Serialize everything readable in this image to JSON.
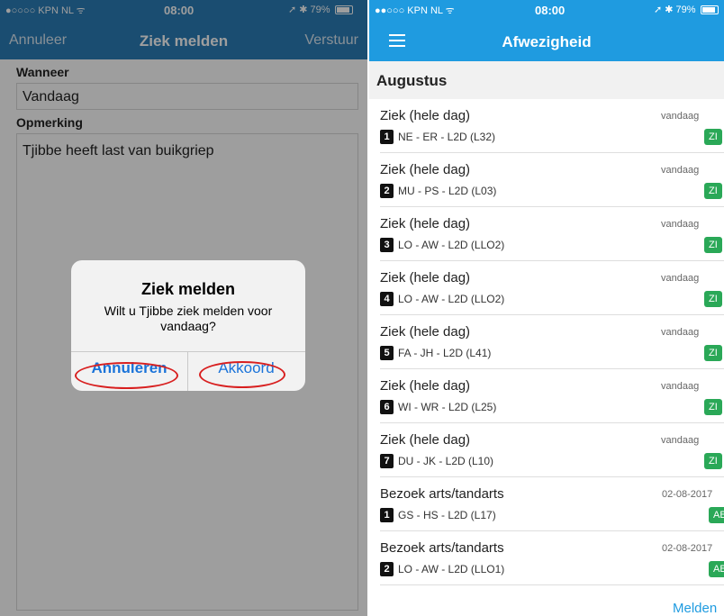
{
  "left": {
    "status": {
      "signal": "●○○○○ KPN NL ᯤ",
      "time": "08:00",
      "battery": "➚ ✱ 79%"
    },
    "nav": {
      "cancel": "Annuleer",
      "title": "Ziek melden",
      "send": "Verstuur"
    },
    "form": {
      "when_label": "Wanneer",
      "when_value": "Vandaag",
      "remark_label": "Opmerking",
      "remark_value": "Tjibbe heeft last van buikgriep"
    },
    "alert": {
      "title": "Ziek melden",
      "message": "Wilt u Tjibbe ziek melden voor vandaag?",
      "cancel": "Annuleren",
      "ok": "Akkoord"
    },
    "colors": {
      "nav": "#2a7cb6",
      "alert_button": "#1a73d9",
      "annotation": "#d81f1f"
    }
  },
  "right": {
    "status": {
      "signal": "●●○○○ KPN NL ᯤ",
      "time": "08:00",
      "battery": "➚ ✱ 79%"
    },
    "nav": {
      "menu_icon": "hamburger-icon",
      "title": "Afwezigheid"
    },
    "section": "Augustus",
    "rows": [
      {
        "title": "Ziek (hele dag)",
        "num": "1",
        "code": "NE - ER - L2D (L32)",
        "date": "vandaag",
        "badge": "ZI"
      },
      {
        "title": "Ziek (hele dag)",
        "num": "2",
        "code": "MU - PS - L2D (L03)",
        "date": "vandaag",
        "badge": "ZI"
      },
      {
        "title": "Ziek (hele dag)",
        "num": "3",
        "code": "LO - AW - L2D (LLO2)",
        "date": "vandaag",
        "badge": "ZI"
      },
      {
        "title": "Ziek (hele dag)",
        "num": "4",
        "code": "LO - AW - L2D (LLO2)",
        "date": "vandaag",
        "badge": "ZI"
      },
      {
        "title": "Ziek (hele dag)",
        "num": "5",
        "code": "FA - JH - L2D (L41)",
        "date": "vandaag",
        "badge": "ZI"
      },
      {
        "title": "Ziek (hele dag)",
        "num": "6",
        "code": "WI - WR - L2D (L25)",
        "date": "vandaag",
        "badge": "ZI"
      },
      {
        "title": "Ziek (hele dag)",
        "num": "7",
        "code": "DU - JK - L2D (L10)",
        "date": "vandaag",
        "badge": "ZI"
      },
      {
        "title": "Bezoek arts/tandarts",
        "num": "1",
        "code": "GS - HS - L2D (L17)",
        "date": "02-08-2017",
        "badge": "AB"
      },
      {
        "title": "Bezoek arts/tandarts",
        "num": "2",
        "code": "LO - AW - L2D (LLO1)",
        "date": "02-08-2017",
        "badge": "AB"
      }
    ],
    "footer_link": "Melden",
    "colors": {
      "nav": "#1f9be0",
      "badge": "#2aa857"
    }
  }
}
